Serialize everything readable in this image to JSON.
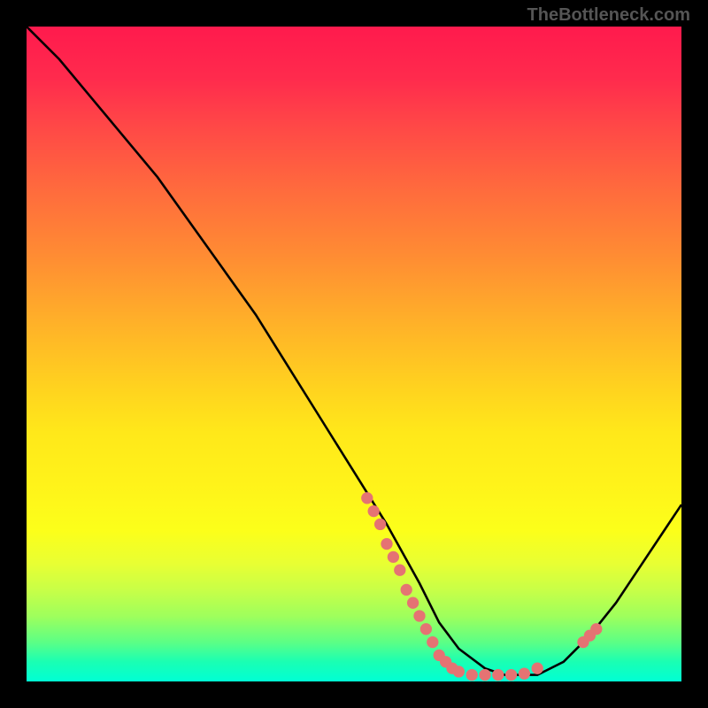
{
  "watermark": "TheBottleneck.com",
  "chart_data": {
    "type": "line",
    "title": "",
    "xlabel": "",
    "ylabel": "",
    "xlim": [
      0,
      100
    ],
    "ylim": [
      0,
      100
    ],
    "x": [
      0,
      5,
      10,
      15,
      20,
      25,
      30,
      35,
      40,
      45,
      50,
      55,
      60,
      63,
      66,
      70,
      73,
      75,
      78,
      82,
      86,
      90,
      94,
      98,
      100
    ],
    "y": [
      100,
      95,
      89,
      83,
      77,
      70,
      63,
      56,
      48,
      40,
      32,
      24,
      15,
      9,
      5,
      2,
      1,
      1,
      1,
      3,
      7,
      12,
      18,
      24,
      27
    ],
    "markers": [
      {
        "x": 52,
        "y": 28
      },
      {
        "x": 53,
        "y": 26
      },
      {
        "x": 54,
        "y": 24
      },
      {
        "x": 55,
        "y": 21
      },
      {
        "x": 56,
        "y": 19
      },
      {
        "x": 57,
        "y": 17
      },
      {
        "x": 58,
        "y": 14
      },
      {
        "x": 59,
        "y": 12
      },
      {
        "x": 60,
        "y": 10
      },
      {
        "x": 61,
        "y": 8
      },
      {
        "x": 62,
        "y": 6
      },
      {
        "x": 63,
        "y": 4
      },
      {
        "x": 64,
        "y": 3
      },
      {
        "x": 65,
        "y": 2
      },
      {
        "x": 66,
        "y": 1.5
      },
      {
        "x": 68,
        "y": 1
      },
      {
        "x": 70,
        "y": 1
      },
      {
        "x": 72,
        "y": 1
      },
      {
        "x": 74,
        "y": 1
      },
      {
        "x": 76,
        "y": 1.2
      },
      {
        "x": 78,
        "y": 2
      },
      {
        "x": 85,
        "y": 6
      },
      {
        "x": 86,
        "y": 7
      },
      {
        "x": 87,
        "y": 8
      }
    ],
    "line_color": "#000000",
    "marker_color": "#e57373",
    "background_gradient": {
      "top": "#ff1a4d",
      "mid": "#fff31a",
      "bottom": "#00ffd4"
    }
  }
}
